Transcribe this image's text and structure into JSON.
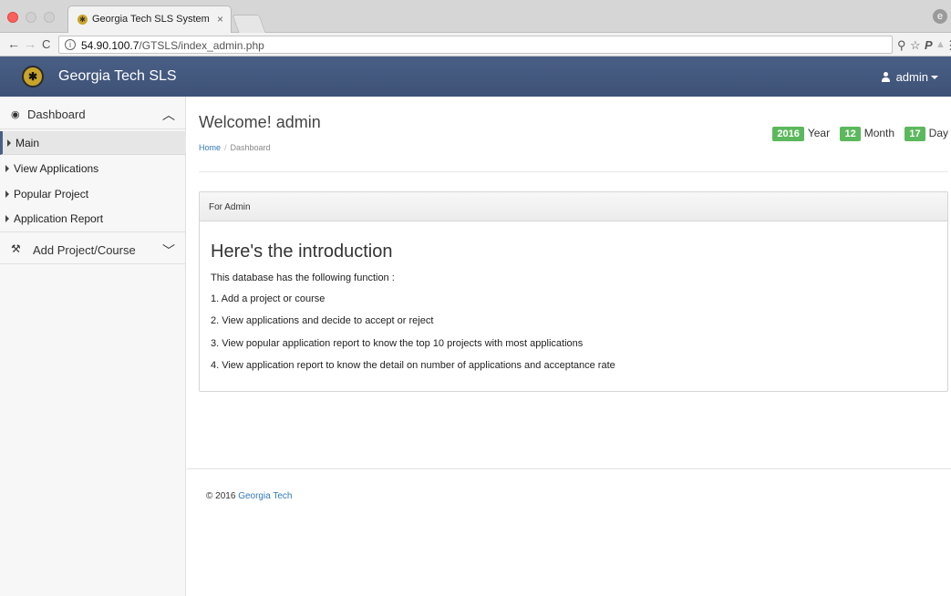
{
  "browser": {
    "tab_title": "Georgia Tech SLS System",
    "tab_close": "×",
    "url_host": "54.90.100.7",
    "url_path": "/GTSLS/index_admin.php",
    "info_glyph": "i",
    "back_glyph": "←",
    "forward_glyph": "→",
    "reload_glyph": "C",
    "ext_key_glyph": "⚲",
    "ext_star_glyph": "☆",
    "ext_p_glyph": "P",
    "ext_drive_glyph": "▲",
    "ext_menu_glyph": "⋮",
    "profile_glyph": "e"
  },
  "navbar": {
    "brand": "Georgia Tech SLS",
    "user": "admin"
  },
  "sidebar": {
    "dashboard_label": "Dashboard",
    "items": [
      {
        "label": "Main",
        "active": true
      },
      {
        "label": "View Applications"
      },
      {
        "label": "Popular Project"
      },
      {
        "label": "Application Report"
      }
    ],
    "add_label": "Add Project/Course"
  },
  "header": {
    "title": "Welcome! admin",
    "breadcrumb_home": "Home",
    "breadcrumb_sep": "/",
    "breadcrumb_current": "Dashboard"
  },
  "date": {
    "year_value": "2016",
    "year_label": "Year",
    "month_value": "12",
    "month_label": "Month",
    "day_value": "17",
    "day_label": "Day"
  },
  "panel": {
    "heading": "For Admin",
    "intro_title": "Here's the introduction",
    "lines": [
      "This database has the following function :",
      "1. Add a project or course",
      "2. View applications and decide to accept or reject",
      "3. View popular application report to know the top 10 projects with most applications",
      "4. View application report to know the detail on number of applications and acceptance rate"
    ]
  },
  "footer": {
    "copyright": "© 2016",
    "link": "Georgia Tech"
  },
  "colors": {
    "navbar": "#4a5f85",
    "badge": "#5cb85c",
    "link": "#337ab7"
  }
}
